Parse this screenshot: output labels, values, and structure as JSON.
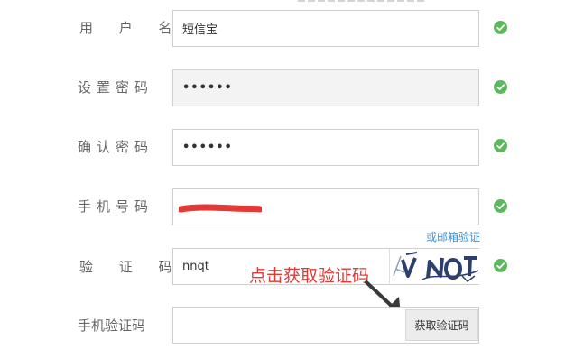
{
  "form": {
    "username": {
      "label": "用 户 名",
      "value": "短信宝",
      "valid": true
    },
    "password": {
      "label": "设置密码",
      "value": "••••••",
      "valid": true
    },
    "confirm_password": {
      "label": "确认密码",
      "value": "••••••",
      "valid": true
    },
    "phone": {
      "label": "手机号码",
      "value": "",
      "redacted": true,
      "valid": true,
      "email_link": "或邮箱验证"
    },
    "captcha": {
      "label": "验 证 码",
      "value": "nnqt",
      "image_alt_text": "NNQT",
      "valid": true
    },
    "sms_code": {
      "label": "手机验证码",
      "value": "",
      "button_label": "获取验证码"
    }
  },
  "annotation": {
    "text": "点击获取验证码",
    "color": "#e53935"
  },
  "colors": {
    "check_green": "#5cb85c",
    "link_blue": "#3c8fd6",
    "redaction_red": "#e53935"
  }
}
